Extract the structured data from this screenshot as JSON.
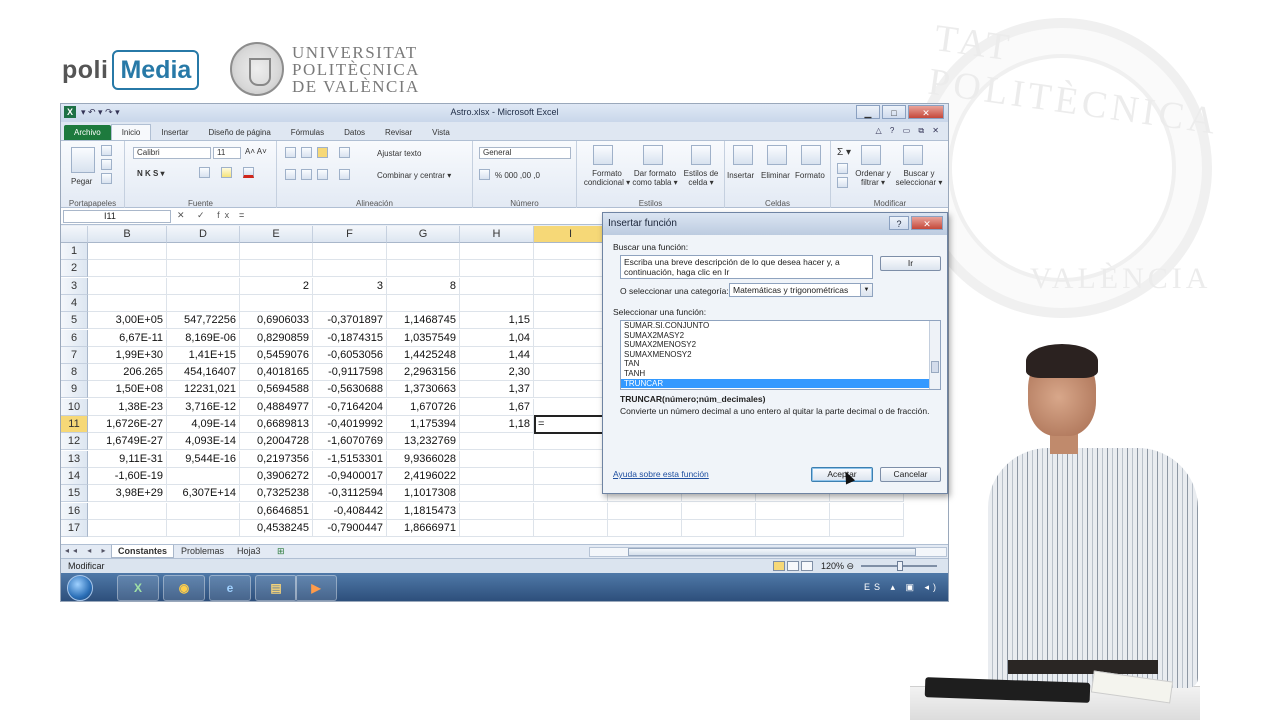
{
  "branding": {
    "poli": "poli",
    "media": "Media",
    "upv_lines": [
      "UNIVERSITAT",
      "POLITÈCNICA",
      "DE VALÈNCIA"
    ],
    "bg_top": "TAT POLITÈCNICA",
    "bg_bottom": "VALÈNCIA"
  },
  "window": {
    "title": "Astro.xlsx - Microsoft Excel",
    "qat": "▾ ↶ ▾ ↷ ▾",
    "min": "▁",
    "max": "□",
    "close": "✕"
  },
  "ribbon_tabs": [
    "Archivo",
    "Inicio",
    "Insertar",
    "Diseño de página",
    "Fórmulas",
    "Datos",
    "Revisar",
    "Vista"
  ],
  "ribbon_right": "△ ? ▭ ⧉ ✕",
  "ribbon": {
    "paste": "Pegar",
    "clipboard": "Portapapeles",
    "font_name": "Calibri",
    "font_size": "11",
    "font_group": "Fuente",
    "font_buttons": "N  K  S ▾",
    "font_grow": "A˄ A˅",
    "wrap_text": "Ajustar texto",
    "merge_center": "Combinar y centrar ▾",
    "alignment": "Alineación",
    "number_format": "General",
    "number_buttons": "% 000 ,00 ,0",
    "number": "Número",
    "cond_format": "Formato condicional ▾",
    "format_table": "Dar formato como tabla ▾",
    "cell_styles": "Estilos de celda ▾",
    "styles": "Estilos",
    "insert": "Insertar",
    "delete": "Eliminar",
    "format": "Formato",
    "cells": "Celdas",
    "sort_filter": "Ordenar y filtrar ▾",
    "find_select": "Buscar y seleccionar ▾",
    "modify": "Modificar",
    "sigma": "Σ ▾"
  },
  "formula_bar": {
    "name_box": "I11",
    "icons": "✕ ✓ fx",
    "value": "="
  },
  "grid": {
    "columns": [
      "B",
      "D",
      "E",
      "F",
      "G",
      "H",
      "I",
      "J",
      "K",
      "L",
      "M"
    ],
    "rows": [
      {
        "n": "1",
        "c": [
          "",
          "",
          "",
          "",
          "",
          ""
        ]
      },
      {
        "n": "2",
        "c": [
          "",
          "",
          "",
          "",
          "",
          ""
        ]
      },
      {
        "n": "3",
        "c": [
          "",
          "",
          "2",
          "3",
          "8",
          ""
        ]
      },
      {
        "n": "4",
        "c": [
          "",
          "",
          "",
          "",
          "",
          ""
        ]
      },
      {
        "n": "5",
        "c": [
          "3,00E+05",
          "547,72256",
          "0,6906033",
          "-0,3701897",
          "1,1468745",
          "1,15"
        ]
      },
      {
        "n": "6",
        "c": [
          "6,67E-11",
          "8,169E-06",
          "0,8290859",
          "-0,1874315",
          "1,0357549",
          "1,04"
        ]
      },
      {
        "n": "7",
        "c": [
          "1,99E+30",
          "1,41E+15",
          "0,5459076",
          "-0,6053056",
          "1,4425248",
          "1,44"
        ]
      },
      {
        "n": "8",
        "c": [
          "206.265",
          "454,16407",
          "0,4018165",
          "-0,9117598",
          "2,2963156",
          "2,30"
        ]
      },
      {
        "n": "9",
        "c": [
          "1,50E+08",
          "12231,021",
          "0,5694588",
          "-0,5630688",
          "1,3730663",
          "1,37"
        ]
      },
      {
        "n": "10",
        "c": [
          "1,38E-23",
          "3,716E-12",
          "0,4884977",
          "-0,7164204",
          "1,670726",
          "1,67"
        ]
      },
      {
        "n": "11",
        "c": [
          "1,6726E-27",
          "4,09E-14",
          "0,6689813",
          "-0,4019992",
          "1,175394",
          "1,18"
        ]
      },
      {
        "n": "12",
        "c": [
          "1,6749E-27",
          "4,093E-14",
          "0,2004728",
          "-1,6070769",
          "13,232769",
          ""
        ]
      },
      {
        "n": "13",
        "c": [
          "9,11E-31",
          "9,544E-16",
          "0,2197356",
          "-1,5153301",
          "9,9366028",
          ""
        ]
      },
      {
        "n": "14",
        "c": [
          "-1,60E-19",
          "",
          "0,3906272",
          "-0,9400017",
          "2,4196022",
          ""
        ]
      },
      {
        "n": "15",
        "c": [
          "3,98E+29",
          "6,307E+14",
          "0,7325238",
          "-0,3112594",
          "1,1017308",
          ""
        ]
      },
      {
        "n": "16",
        "c": [
          "",
          "",
          "0,6646851",
          "-0,408442",
          "1,1815473",
          ""
        ]
      },
      {
        "n": "17",
        "c": [
          "",
          "",
          "0,4538245",
          "-0,7900447",
          "1,8666971",
          ""
        ]
      }
    ],
    "active_value": "="
  },
  "sheets": {
    "nav": "◂◂ ◂ ▸ ▸▸",
    "tabs": [
      "Constantes",
      "Problemas",
      "Hoja3"
    ]
  },
  "status": {
    "mode": "Modificar",
    "zoom": "120%   ⊖"
  },
  "taskbar": {
    "apps": [
      "X",
      "◉",
      "e",
      "▤",
      "▶"
    ],
    "tray": "ES  ▴ ▣ ◂)"
  },
  "dialog": {
    "title": "Insertar función",
    "help_btn": "?",
    "close_btn": "✕",
    "search_label": "Buscar una función:",
    "search_text": "Escriba una breve descripción de lo que desea hacer y, a continuación, haga clic en Ir",
    "go_button": "Ir",
    "category_label": "O seleccionar una categoría:",
    "category_value": "Matemáticas y trigonométricas",
    "function_label": "Seleccionar una función:",
    "functions": [
      "SUMAR.SI.CONJUNTO",
      "SUMAX2MASY2",
      "SUMAX2MENOSY2",
      "SUMAXMENOSY2",
      "TAN",
      "TANH",
      "TRUNCAR"
    ],
    "selected_index": 6,
    "syntax": "TRUNCAR(número;núm_decimales)",
    "description": "Convierte un número decimal a uno entero al quitar la parte decimal o de fracción.",
    "help_link": "Ayuda sobre esta función",
    "ok_button": "Aceptar",
    "cancel_button": "Cancelar"
  },
  "colors": {
    "excel_green": "#1d7a3d",
    "selection_blue": "#3399ff",
    "header_highlight": "#f6d877",
    "brand_blue": "#2779a7"
  }
}
